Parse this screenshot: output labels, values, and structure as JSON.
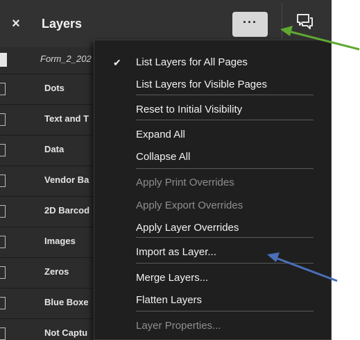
{
  "header": {
    "close_glyph": "×",
    "title": "Layers",
    "more_glyph": "···",
    "comment_icon": "comment-icon"
  },
  "file": {
    "name": "Form_2_202"
  },
  "layers": [
    {
      "name": "Dots"
    },
    {
      "name": "Text and T"
    },
    {
      "name": "Data"
    },
    {
      "name": "Vendor Ba"
    },
    {
      "name": "2D Barcod"
    },
    {
      "name": "Images"
    },
    {
      "name": "Zeros"
    },
    {
      "name": "Blue Boxe"
    },
    {
      "name": "Not Captu"
    }
  ],
  "menu": {
    "check_glyph": "✔",
    "items": [
      {
        "label": "List Layers for All Pages",
        "checked": true,
        "enabled": true
      },
      {
        "label": "List Layers for Visible Pages",
        "checked": false,
        "enabled": true
      },
      {
        "label": "Reset to Initial Visibility",
        "checked": false,
        "enabled": true
      },
      {
        "label": "Expand All",
        "checked": false,
        "enabled": true
      },
      {
        "label": "Collapse All",
        "checked": false,
        "enabled": true
      },
      {
        "label": "Apply Print Overrides",
        "checked": false,
        "enabled": false
      },
      {
        "label": "Apply Export Overrides",
        "checked": false,
        "enabled": false
      },
      {
        "label": "Apply Layer Overrides",
        "checked": false,
        "enabled": true
      },
      {
        "label": "Import as Layer...",
        "checked": false,
        "enabled": true
      },
      {
        "label": "Merge Layers...",
        "checked": false,
        "enabled": true
      },
      {
        "label": "Flatten Layers",
        "checked": false,
        "enabled": true
      },
      {
        "label": "Layer Properties...",
        "checked": false,
        "enabled": false
      }
    ]
  },
  "colors": {
    "panel": "#2c2c2c",
    "menu": "#1f1f1f",
    "arrow_green": "#5fa832",
    "arrow_blue": "#4a6fb8"
  }
}
